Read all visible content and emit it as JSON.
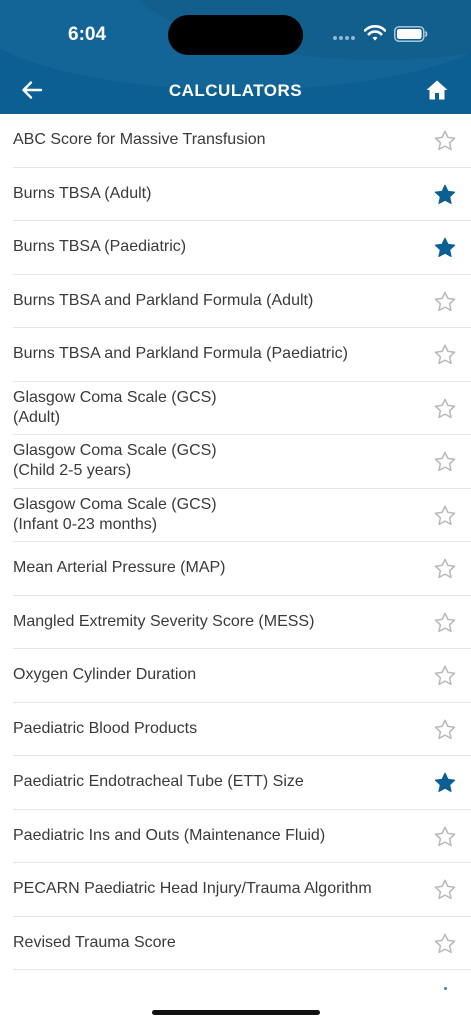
{
  "status_bar": {
    "time": "6:04"
  },
  "header": {
    "title": "CALCULATORS"
  },
  "calculators": [
    {
      "label": "ABC Score for Massive Transfusion",
      "favorite": false
    },
    {
      "label": "Burns TBSA (Adult)",
      "favorite": true
    },
    {
      "label": "Burns TBSA (Paediatric)",
      "favorite": true
    },
    {
      "label": "Burns TBSA and Parkland Formula (Adult)",
      "favorite": false
    },
    {
      "label": "Burns TBSA and Parkland Formula (Paediatric)",
      "favorite": false
    },
    {
      "label": "Glasgow Coma Scale (GCS)\n(Adult)",
      "favorite": false
    },
    {
      "label": "Glasgow Coma Scale (GCS)\n(Child 2-5 years)",
      "favorite": false
    },
    {
      "label": "Glasgow Coma Scale (GCS)\n(Infant 0-23 months)",
      "favorite": false
    },
    {
      "label": "Mean Arterial Pressure (MAP)",
      "favorite": false
    },
    {
      "label": "Mangled Extremity Severity Score (MESS)",
      "favorite": false
    },
    {
      "label": "Oxygen Cylinder Duration",
      "favorite": false
    },
    {
      "label": "Paediatric Blood Products",
      "favorite": false
    },
    {
      "label": "Paediatric Endotracheal Tube (ETT) Size",
      "favorite": true
    },
    {
      "label": "Paediatric Ins and Outs (Maintenance Fluid)",
      "favorite": false
    },
    {
      "label": "PECARN Paediatric Head Injury/Trauma Algorithm",
      "favorite": false
    },
    {
      "label": "Revised Trauma Score",
      "favorite": false
    }
  ],
  "colors": {
    "header_bg": "#0b5f93",
    "star_filled": "#0b5f93",
    "star_outline": "#b9b9b9",
    "text": "#3a3a3a",
    "divider": "#e6e6e6"
  },
  "icons": {
    "back": "arrow-left-icon",
    "home": "home-icon",
    "favorite_on": "star-filled-icon",
    "favorite_off": "star-outline-icon",
    "wifi": "wifi-icon",
    "battery": "battery-icon"
  }
}
